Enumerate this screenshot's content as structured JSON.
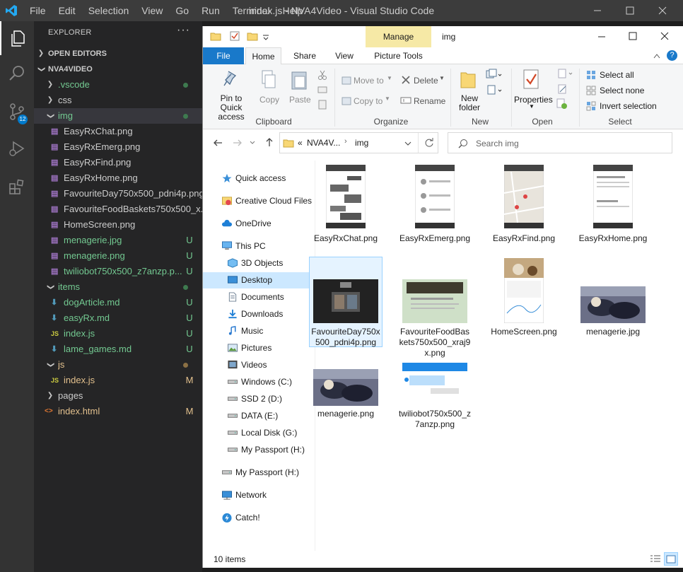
{
  "vscode": {
    "menu": [
      "File",
      "Edit",
      "Selection",
      "View",
      "Go",
      "Run",
      "Terminal",
      "Help"
    ],
    "window_title": "index.js - NVA4Video - Visual Studio Code",
    "scm_badge": "12",
    "explorer_header": "EXPLORER",
    "more_actions": "···",
    "open_editors": "OPEN EDITORS",
    "project": "NVA4VIDEO",
    "tree": [
      {
        "label": ".vscode",
        "kind": "folder",
        "state": "closed",
        "status": "dot"
      },
      {
        "label": "css",
        "kind": "folder",
        "state": "closed",
        "status": ""
      },
      {
        "label": "img",
        "kind": "folder",
        "state": "open",
        "status": "dot"
      },
      {
        "label": "EasyRxChat.png",
        "kind": "image",
        "status": ""
      },
      {
        "label": "EasyRxEmerg.png",
        "kind": "image",
        "status": ""
      },
      {
        "label": "EasyRxFind.png",
        "kind": "image",
        "status": ""
      },
      {
        "label": "EasyRxHome.png",
        "kind": "image",
        "status": ""
      },
      {
        "label": "FavouriteDay750x500_pdni4p.png",
        "kind": "image",
        "status": ""
      },
      {
        "label": "FavouriteFoodBaskets750x500_x...",
        "kind": "image",
        "status": ""
      },
      {
        "label": "HomeScreen.png",
        "kind": "image",
        "status": ""
      },
      {
        "label": "menagerie.jpg",
        "kind": "image",
        "status": "U"
      },
      {
        "label": "menagerie.png",
        "kind": "image",
        "status": "U"
      },
      {
        "label": "twiliobot750x500_z7anzp.p...",
        "kind": "image",
        "status": "U"
      },
      {
        "label": "items",
        "kind": "folder",
        "state": "open",
        "status": "dot"
      },
      {
        "label": "dogArticle.md",
        "kind": "md",
        "status": "U"
      },
      {
        "label": "easyRx.md",
        "kind": "md",
        "status": "U"
      },
      {
        "label": "index.js",
        "kind": "js",
        "status": "U"
      },
      {
        "label": "lame_games.md",
        "kind": "md",
        "status": "U"
      },
      {
        "label": "js",
        "kind": "folder",
        "state": "open",
        "status": "dotbrown"
      },
      {
        "label": "index.js",
        "kind": "js",
        "status": "M"
      },
      {
        "label": "pages",
        "kind": "folder",
        "state": "closed",
        "status": ""
      },
      {
        "label": "index.html",
        "kind": "html",
        "status": "M"
      }
    ]
  },
  "explorer": {
    "manage_tab": "Manage",
    "folder_title": "img",
    "tabs": [
      "File",
      "Home",
      "Share",
      "View",
      "Picture Tools"
    ],
    "ribbon": {
      "pin": "Pin to Quick access",
      "copy": "Copy",
      "paste": "Paste",
      "clipboard": "Clipboard",
      "move_to": "Move to",
      "copy_to": "Copy to",
      "delete": "Delete",
      "rename": "Rename",
      "organize": "Organize",
      "new_folder": "New folder",
      "new": "New",
      "properties": "Properties",
      "open": "Open",
      "select_all": "Select all",
      "select_none": "Select none",
      "invert_selection": "Invert selection",
      "select": "Select"
    },
    "address": {
      "prefix": "«",
      "crumbs": [
        "NVA4V...",
        "img"
      ]
    },
    "search_placeholder": "Search img",
    "nav": [
      {
        "label": "Quick access",
        "icon": "star"
      },
      {
        "label": "Creative Cloud Files",
        "icon": "cc"
      },
      {
        "label": "OneDrive",
        "icon": "cloud"
      },
      {
        "label": "This PC",
        "icon": "pc"
      },
      {
        "label": "3D Objects",
        "icon": "cube"
      },
      {
        "label": "Desktop",
        "icon": "desktop"
      },
      {
        "label": "Documents",
        "icon": "doc"
      },
      {
        "label": "Downloads",
        "icon": "download"
      },
      {
        "label": "Music",
        "icon": "music"
      },
      {
        "label": "Pictures",
        "icon": "pictures"
      },
      {
        "label": "Videos",
        "icon": "videos"
      },
      {
        "label": "Windows (C:)",
        "icon": "drive"
      },
      {
        "label": "SSD 2 (D:)",
        "icon": "drive"
      },
      {
        "label": "DATA (E:)",
        "icon": "drive"
      },
      {
        "label": "Local Disk (G:)",
        "icon": "drive"
      },
      {
        "label": "My Passport (H:)",
        "icon": "drive"
      },
      {
        "label": "My Passport (H:)",
        "icon": "drive"
      },
      {
        "label": "Network",
        "icon": "network"
      },
      {
        "label": "Catch!",
        "icon": "catch"
      }
    ],
    "files": [
      "EasyRxChat.png",
      "EasyRxEmerg.png",
      "EasyRxFind.png",
      "EasyRxHome.png",
      "FavouriteDay750x500_pdni4p.png",
      "FavouriteFoodBaskets750x500_xraj9x.png",
      "HomeScreen.png",
      "menagerie.jpg",
      "menagerie.png",
      "twiliobot750x500_z7anzp.png"
    ],
    "status": "10 items"
  },
  "colors": {
    "git_untracked": "#73c991",
    "git_modified": "#e2c08d",
    "accent": "#007acc",
    "file_tab": "#1979ca"
  }
}
